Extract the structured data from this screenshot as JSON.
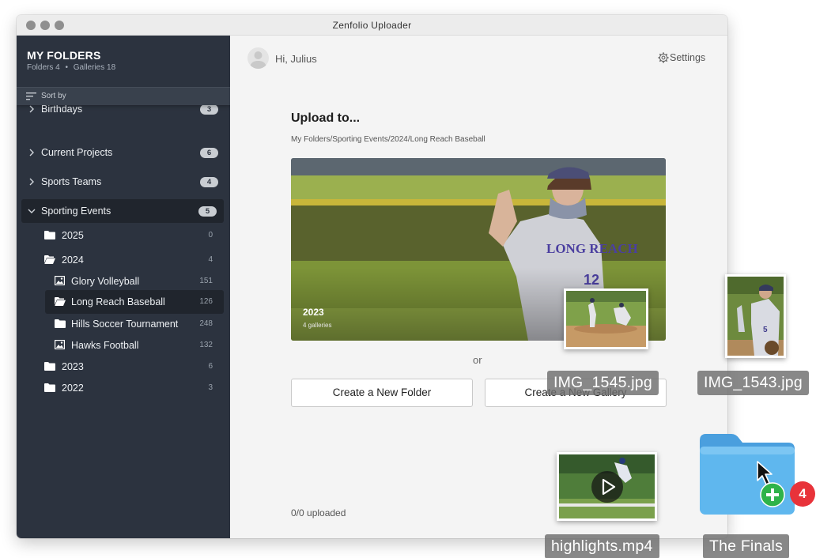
{
  "window": {
    "title": "Zenfolio Uploader"
  },
  "sidebar": {
    "title": "MY FOLDERS",
    "folders_label": "Folders 4",
    "galleries_label": "Galleries 18",
    "sort_label": "Sort by",
    "items": [
      {
        "label": "Birthdays",
        "count": "3"
      },
      {
        "label": "Current Projects",
        "count": "6"
      },
      {
        "label": "Sports Teams",
        "count": "4"
      },
      {
        "label": "Sporting Events",
        "count": "5"
      }
    ],
    "sporting_children": [
      {
        "label": "2025",
        "count": "0"
      },
      {
        "label": "2024",
        "count": "4"
      },
      {
        "label": "Glory Volleyball",
        "count": "151"
      },
      {
        "label": "Long Reach Baseball",
        "count": "126"
      },
      {
        "label": "Hills Soccer Tournament",
        "count": "248"
      },
      {
        "label": "Hawks Football",
        "count": "132"
      },
      {
        "label": "2023",
        "count": "6"
      },
      {
        "label": "2022",
        "count": "3"
      }
    ]
  },
  "header": {
    "greeting": "Hi, Julius",
    "settings_label": "Settings"
  },
  "upload": {
    "title": "Upload to...",
    "path": "My Folders/Sporting Events/2024/Long Reach Baseball",
    "preview_year": "2023",
    "preview_sub": "4 galleries",
    "or_label": "or",
    "new_folder_label": "Create a New Folder",
    "new_gallery_label": "Create a New Gallery",
    "status": "0/0 uploaded"
  },
  "desktop": {
    "files": [
      {
        "name": "IMG_1545.jpg"
      },
      {
        "name": "IMG_1543.jpg"
      },
      {
        "name": "highlights.mp4"
      }
    ],
    "folder_name": "The Finals",
    "drag_count": "4"
  },
  "colors": {
    "sidebar_bg": "#2c333f",
    "accent_green": "#2fb34a",
    "badge_red": "#e8333a",
    "folder_blue": "#5fb7ee"
  }
}
